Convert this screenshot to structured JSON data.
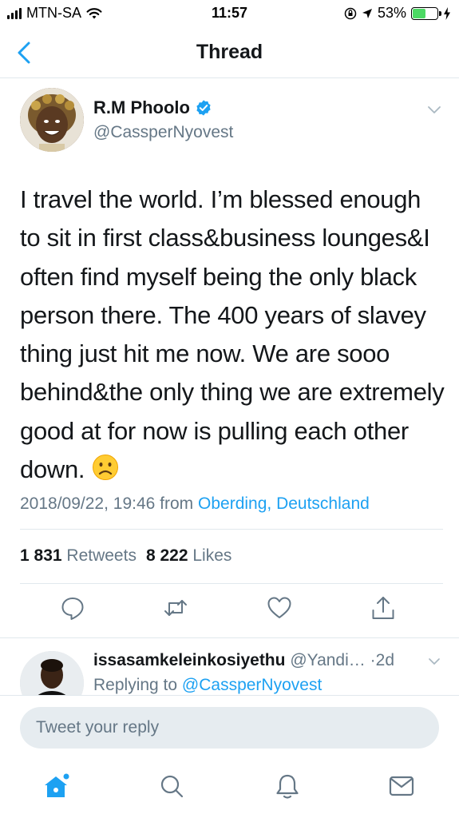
{
  "status_bar": {
    "carrier": "MTN-SA",
    "time": "11:57",
    "battery_percent": "53%",
    "battery_level": 0.53,
    "battery_color": "#4cd964"
  },
  "nav": {
    "back_icon": "chevron-left-icon",
    "title": "Thread"
  },
  "tweet": {
    "author_name": "R.M Phoolo",
    "author_handle": "@CassperNyovest",
    "verified": true,
    "text": "I travel the world. I’m blessed enough to sit in first class&business lounges&I often find myself being the only black person there. The 400 years of slavey thing just hit me now. We are sooo behind&the only thing we are extremely good at for now is pulling each other down.",
    "emoji": "frowning-face",
    "timestamp": "2018/09/22, 19:46",
    "from_label": "from",
    "location": "Oberding, Deutschland",
    "retweets_count": "1 831",
    "retweets_label": "Retweets",
    "likes_count": "8 222",
    "likes_label": "Likes"
  },
  "actions": [
    {
      "icon": "reply-icon"
    },
    {
      "icon": "retweet-icon"
    },
    {
      "icon": "heart-icon"
    },
    {
      "icon": "share-icon"
    }
  ],
  "reply": {
    "name": "issasamkeleinkosiyethu",
    "handle": "@Yandi…",
    "separator": "·",
    "age": "2d",
    "replying_label": "Replying to",
    "replying_to": "@CassperNyovest"
  },
  "composer": {
    "placeholder": "Tweet your reply"
  },
  "tab_bar": [
    {
      "icon": "home-icon",
      "active": true
    },
    {
      "icon": "search-icon",
      "active": false
    },
    {
      "icon": "notifications-icon",
      "active": false
    },
    {
      "icon": "messages-icon",
      "active": false
    }
  ],
  "colors": {
    "accent": "#1da1f2",
    "text": "#14171a",
    "secondary": "#657786",
    "divider": "#e1e8ed"
  }
}
